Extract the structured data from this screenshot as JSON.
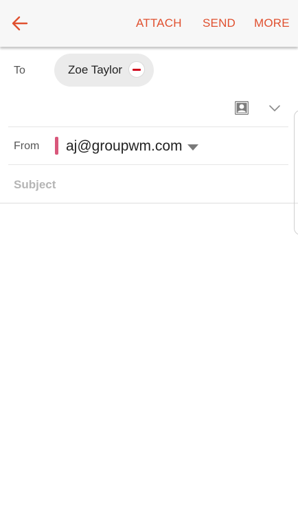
{
  "toolbar": {
    "back_icon": "arrow-left-icon",
    "attach_label": "ATTACH",
    "send_label": "SEND",
    "more_label": "MORE",
    "accent_color": "#e0502f"
  },
  "recipients": {
    "to_label": "To",
    "chips": [
      {
        "name": "Zoe Taylor",
        "remove_icon": "minus-circle-icon"
      }
    ],
    "contacts_icon": "contact-card-icon",
    "expand_icon": "chevron-down-icon"
  },
  "sender": {
    "from_label": "From",
    "account": "aj@groupwm.com",
    "account_color": "#d9577b",
    "dropdown_icon": "caret-down-icon"
  },
  "subject": {
    "placeholder": "Subject",
    "value": ""
  },
  "body": {
    "value": ""
  }
}
